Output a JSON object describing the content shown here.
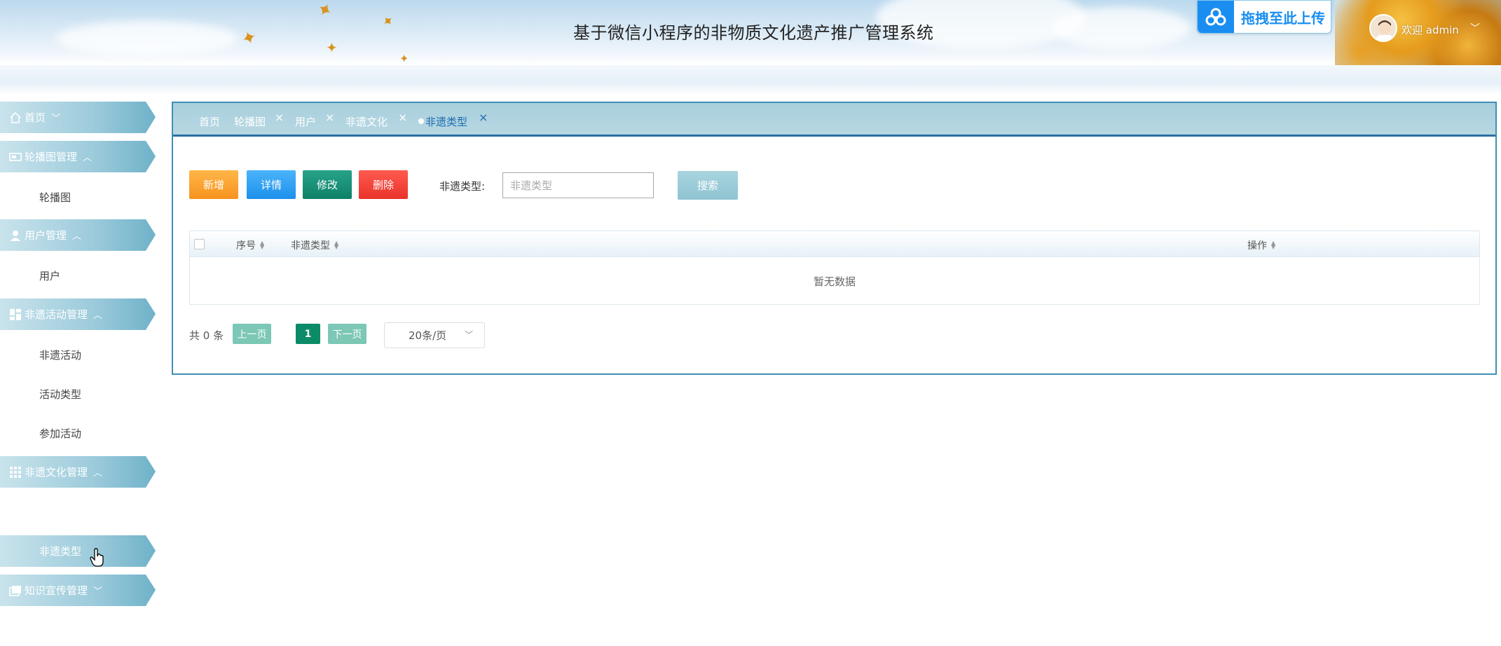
{
  "header": {
    "title": "基于微信小程序的非物质文化遗产推广管理系统",
    "upload_label": "拖拽至此上传",
    "welcome": "欢迎 admin"
  },
  "sidebar": {
    "items": [
      {
        "type": "group",
        "label": "首页",
        "icon": "home-icon",
        "caret": "﹀"
      },
      {
        "type": "group",
        "label": "轮播图管理",
        "icon": "carousel-icon",
        "caret": "︿"
      },
      {
        "type": "sub",
        "label": "轮播图"
      },
      {
        "type": "group",
        "label": "用户管理",
        "icon": "user-icon",
        "caret": "︿"
      },
      {
        "type": "sub",
        "label": "用户"
      },
      {
        "type": "group",
        "label": "非遗活动管理",
        "icon": "dashboard-icon",
        "caret": "︿"
      },
      {
        "type": "sub",
        "label": "非遗活动"
      },
      {
        "type": "sub",
        "label": "活动类型"
      },
      {
        "type": "sub",
        "label": "参加活动"
      },
      {
        "type": "group",
        "label": "非遗文化管理",
        "icon": "grid-icon",
        "caret": "︿"
      },
      {
        "type": "sub",
        "label": "非遗类型",
        "active": true
      },
      {
        "type": "group",
        "label": "知识宣传管理",
        "icon": "book-icon",
        "caret": "﹀"
      }
    ]
  },
  "tabs": [
    {
      "label": "首页",
      "closable": false
    },
    {
      "label": "轮播图",
      "closable": true
    },
    {
      "label": "用户",
      "closable": true
    },
    {
      "label": "非遗文化",
      "closable": true
    },
    {
      "label": "非遗类型",
      "closable": true,
      "active": true
    }
  ],
  "toolbar": {
    "add": "新增",
    "detail": "详情",
    "edit": "修改",
    "delete": "删除",
    "search_label": "非遗类型:",
    "search_placeholder": "非遗类型",
    "search_button": "搜索"
  },
  "table": {
    "columns": [
      "序号",
      "非遗类型",
      "操作"
    ],
    "empty_text": "暂无数据"
  },
  "pagination": {
    "total": "共 0 条",
    "prev": "上一页",
    "page": "1",
    "next": "下一页",
    "page_size": "20条/页"
  },
  "colors": {
    "accent": "#3f8fb6",
    "add": "#f7931e",
    "detail": "#1e90ec",
    "edit": "#0d8067",
    "delete": "#e9332a",
    "page_active": "#0c8b69"
  }
}
